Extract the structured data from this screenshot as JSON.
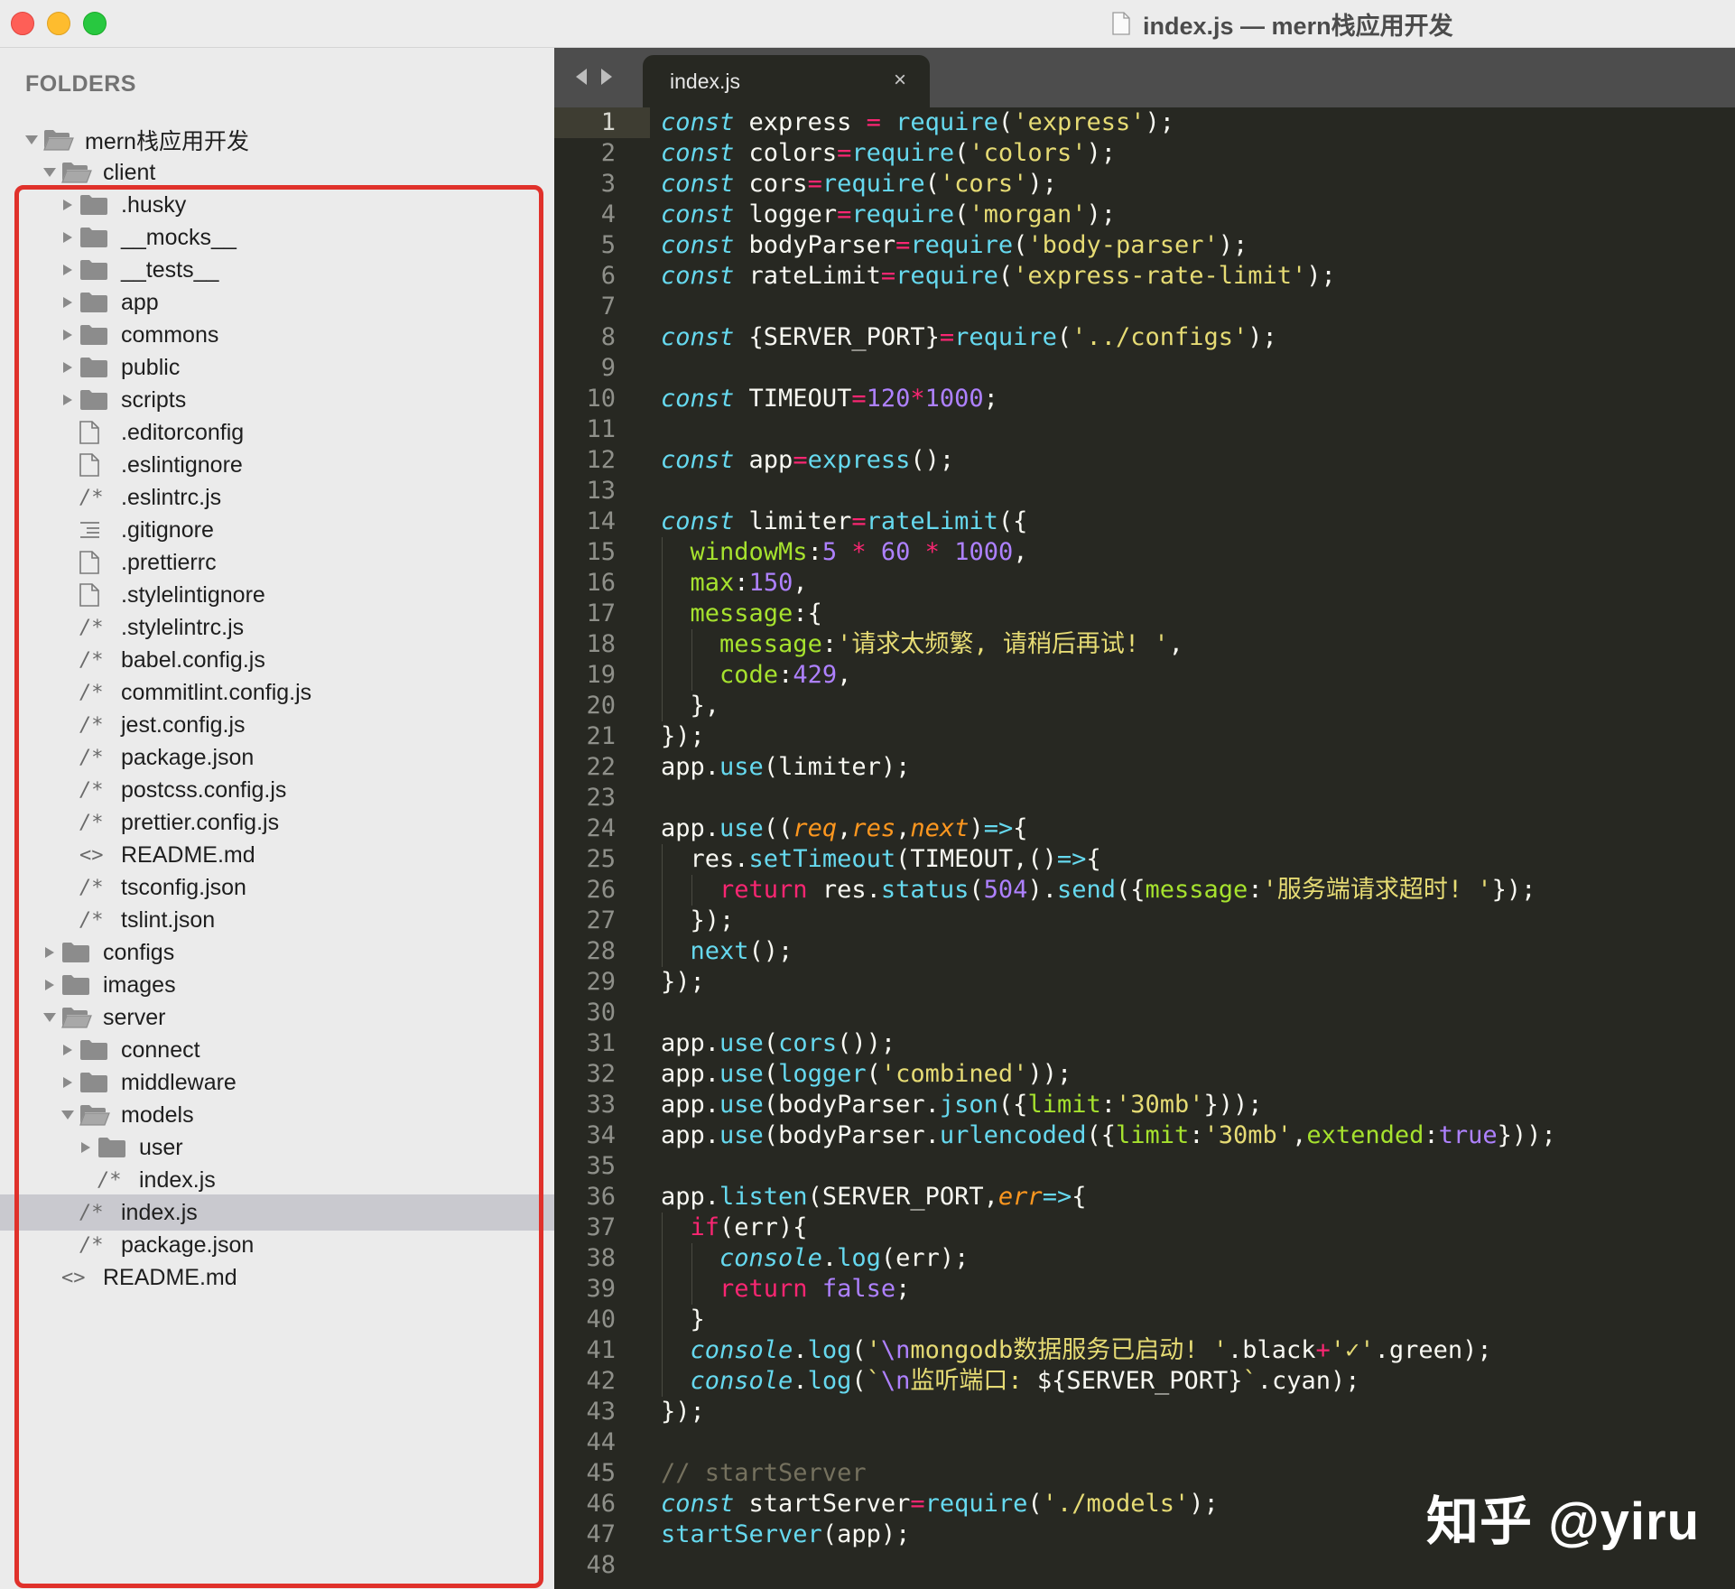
{
  "window": {
    "title": "index.js — mern栈应用开发"
  },
  "sidebar": {
    "header": "FOLDERS",
    "items": [
      {
        "label": "mern栈应用开发",
        "kind": "folder-open",
        "depth": 0
      },
      {
        "label": "client",
        "kind": "folder-open",
        "depth": 1
      },
      {
        "label": ".husky",
        "kind": "folder",
        "depth": 2
      },
      {
        "label": "__mocks__",
        "kind": "folder",
        "depth": 2
      },
      {
        "label": "__tests__",
        "kind": "folder",
        "depth": 2
      },
      {
        "label": "app",
        "kind": "folder",
        "depth": 2
      },
      {
        "label": "commons",
        "kind": "folder",
        "depth": 2
      },
      {
        "label": "public",
        "kind": "folder",
        "depth": 2
      },
      {
        "label": "scripts",
        "kind": "folder",
        "depth": 2
      },
      {
        "label": ".editorconfig",
        "kind": "file",
        "depth": 2
      },
      {
        "label": ".eslintignore",
        "kind": "file",
        "depth": 2
      },
      {
        "label": ".eslintrc.js",
        "kind": "js",
        "depth": 2
      },
      {
        "label": ".gitignore",
        "kind": "list",
        "depth": 2
      },
      {
        "label": ".prettierrc",
        "kind": "file",
        "depth": 2
      },
      {
        "label": ".stylelintignore",
        "kind": "file",
        "depth": 2
      },
      {
        "label": ".stylelintrc.js",
        "kind": "js",
        "depth": 2
      },
      {
        "label": "babel.config.js",
        "kind": "js",
        "depth": 2
      },
      {
        "label": "commitlint.config.js",
        "kind": "js",
        "depth": 2
      },
      {
        "label": "jest.config.js",
        "kind": "js",
        "depth": 2
      },
      {
        "label": "package.json",
        "kind": "js",
        "depth": 2
      },
      {
        "label": "postcss.config.js",
        "kind": "js",
        "depth": 2
      },
      {
        "label": "prettier.config.js",
        "kind": "js",
        "depth": 2
      },
      {
        "label": "README.md",
        "kind": "md",
        "depth": 2
      },
      {
        "label": "tsconfig.json",
        "kind": "js",
        "depth": 2
      },
      {
        "label": "tslint.json",
        "kind": "js",
        "depth": 2
      },
      {
        "label": "configs",
        "kind": "folder",
        "depth": 1
      },
      {
        "label": "images",
        "kind": "folder",
        "depth": 1
      },
      {
        "label": "server",
        "kind": "folder-open",
        "depth": 1
      },
      {
        "label": "connect",
        "kind": "folder",
        "depth": 2
      },
      {
        "label": "middleware",
        "kind": "folder",
        "depth": 2
      },
      {
        "label": "models",
        "kind": "folder-open",
        "depth": 2
      },
      {
        "label": "user",
        "kind": "folder",
        "depth": 3
      },
      {
        "label": "index.js",
        "kind": "js",
        "depth": 3
      },
      {
        "label": "index.js",
        "kind": "js",
        "depth": 2,
        "selected": true
      },
      {
        "label": "package.json",
        "kind": "js",
        "depth": 2
      },
      {
        "label": "README.md",
        "kind": "md",
        "depth": 1
      }
    ]
  },
  "editor": {
    "tab_label": "index.js",
    "tab_close": "×",
    "lines": [
      [
        [
          "st",
          "const"
        ],
        [
          "t",
          " express "
        ],
        [
          "k",
          "="
        ],
        [
          "t",
          " "
        ],
        [
          "f",
          "require"
        ],
        [
          "t",
          "("
        ],
        [
          "s",
          "'express'"
        ],
        [
          "t",
          ");"
        ]
      ],
      [
        [
          "st",
          "const"
        ],
        [
          "t",
          " colors"
        ],
        [
          "k",
          "="
        ],
        [
          "f",
          "require"
        ],
        [
          "t",
          "("
        ],
        [
          "s",
          "'colors'"
        ],
        [
          "t",
          ");"
        ]
      ],
      [
        [
          "st",
          "const"
        ],
        [
          "t",
          " cors"
        ],
        [
          "k",
          "="
        ],
        [
          "f",
          "require"
        ],
        [
          "t",
          "("
        ],
        [
          "s",
          "'cors'"
        ],
        [
          "t",
          ");"
        ]
      ],
      [
        [
          "st",
          "const"
        ],
        [
          "t",
          " logger"
        ],
        [
          "k",
          "="
        ],
        [
          "f",
          "require"
        ],
        [
          "t",
          "("
        ],
        [
          "s",
          "'morgan'"
        ],
        [
          "t",
          ");"
        ]
      ],
      [
        [
          "st",
          "const"
        ],
        [
          "t",
          " bodyParser"
        ],
        [
          "k",
          "="
        ],
        [
          "f",
          "require"
        ],
        [
          "t",
          "("
        ],
        [
          "s",
          "'body-parser'"
        ],
        [
          "t",
          ");"
        ]
      ],
      [
        [
          "st",
          "const"
        ],
        [
          "t",
          " rateLimit"
        ],
        [
          "k",
          "="
        ],
        [
          "f",
          "require"
        ],
        [
          "t",
          "("
        ],
        [
          "s",
          "'express-rate-limit'"
        ],
        [
          "t",
          ");"
        ]
      ],
      [],
      [
        [
          "st",
          "const"
        ],
        [
          "t",
          " {SERVER_PORT}"
        ],
        [
          "k",
          "="
        ],
        [
          "f",
          "require"
        ],
        [
          "t",
          "("
        ],
        [
          "s",
          "'../configs'"
        ],
        [
          "t",
          ");"
        ]
      ],
      [],
      [
        [
          "st",
          "const"
        ],
        [
          "t",
          " TIMEOUT"
        ],
        [
          "k",
          "="
        ],
        [
          "n",
          "120"
        ],
        [
          "k",
          "*"
        ],
        [
          "n",
          "1000"
        ],
        [
          "t",
          ";"
        ]
      ],
      [],
      [
        [
          "st",
          "const"
        ],
        [
          "t",
          " app"
        ],
        [
          "k",
          "="
        ],
        [
          "f",
          "express"
        ],
        [
          "t",
          "();"
        ]
      ],
      [],
      [
        [
          "st",
          "const"
        ],
        [
          "t",
          " limiter"
        ],
        [
          "k",
          "="
        ],
        [
          "f",
          "rateLimit"
        ],
        [
          "t",
          "({"
        ]
      ],
      [
        [
          "t",
          "  "
        ],
        [
          "pr",
          "windowMs"
        ],
        [
          "t",
          ":"
        ],
        [
          "n",
          "5"
        ],
        [
          "t",
          " "
        ],
        [
          "k",
          "*"
        ],
        [
          "t",
          " "
        ],
        [
          "n",
          "60"
        ],
        [
          "t",
          " "
        ],
        [
          "k",
          "*"
        ],
        [
          "t",
          " "
        ],
        [
          "n",
          "1000"
        ],
        [
          "t",
          ","
        ]
      ],
      [
        [
          "t",
          "  "
        ],
        [
          "pr",
          "max"
        ],
        [
          "t",
          ":"
        ],
        [
          "n",
          "150"
        ],
        [
          "t",
          ","
        ]
      ],
      [
        [
          "t",
          "  "
        ],
        [
          "pr",
          "message"
        ],
        [
          "t",
          ":{"
        ]
      ],
      [
        [
          "t",
          "    "
        ],
        [
          "pr",
          "message"
        ],
        [
          "t",
          ":"
        ],
        [
          "s",
          "'请求太频繁, 请稍后再试! '"
        ],
        [
          "t",
          ","
        ]
      ],
      [
        [
          "t",
          "    "
        ],
        [
          "pr",
          "code"
        ],
        [
          "t",
          ":"
        ],
        [
          "n",
          "429"
        ],
        [
          "t",
          ","
        ]
      ],
      [
        [
          "t",
          "  },"
        ]
      ],
      [
        [
          "t",
          "});"
        ]
      ],
      [
        [
          "t",
          "app."
        ],
        [
          "f",
          "use"
        ],
        [
          "t",
          "(limiter);"
        ]
      ],
      [],
      [
        [
          "t",
          "app."
        ],
        [
          "f",
          "use"
        ],
        [
          "t",
          "(("
        ],
        [
          "p",
          "req"
        ],
        [
          "t",
          ","
        ],
        [
          "p",
          "res"
        ],
        [
          "t",
          ","
        ],
        [
          "p",
          "next"
        ],
        [
          "t",
          ")"
        ],
        [
          "st",
          "=>"
        ],
        [
          "t",
          "{"
        ]
      ],
      [
        [
          "t",
          "  res."
        ],
        [
          "f",
          "setTimeout"
        ],
        [
          "t",
          "(TIMEOUT,()"
        ],
        [
          "st",
          "=>"
        ],
        [
          "t",
          "{"
        ]
      ],
      [
        [
          "t",
          "    "
        ],
        [
          "k",
          "return"
        ],
        [
          "t",
          " res."
        ],
        [
          "f",
          "status"
        ],
        [
          "t",
          "("
        ],
        [
          "n",
          "504"
        ],
        [
          "t",
          ")."
        ],
        [
          "f",
          "send"
        ],
        [
          "t",
          "({"
        ],
        [
          "pr",
          "message"
        ],
        [
          "t",
          ":"
        ],
        [
          "s",
          "'服务端请求超时! '"
        ],
        [
          "t",
          "});"
        ]
      ],
      [
        [
          "t",
          "  });"
        ]
      ],
      [
        [
          "t",
          "  "
        ],
        [
          "f",
          "next"
        ],
        [
          "t",
          "();"
        ]
      ],
      [
        [
          "t",
          "});"
        ]
      ],
      [],
      [
        [
          "t",
          "app."
        ],
        [
          "f",
          "use"
        ],
        [
          "t",
          "("
        ],
        [
          "f",
          "cors"
        ],
        [
          "t",
          "());"
        ]
      ],
      [
        [
          "t",
          "app."
        ],
        [
          "f",
          "use"
        ],
        [
          "t",
          "("
        ],
        [
          "f",
          "logger"
        ],
        [
          "t",
          "("
        ],
        [
          "s",
          "'combined'"
        ],
        [
          "t",
          "));"
        ]
      ],
      [
        [
          "t",
          "app."
        ],
        [
          "f",
          "use"
        ],
        [
          "t",
          "(bodyParser."
        ],
        [
          "f",
          "json"
        ],
        [
          "t",
          "({"
        ],
        [
          "pr",
          "limit"
        ],
        [
          "t",
          ":"
        ],
        [
          "s",
          "'30mb'"
        ],
        [
          "t",
          "}));"
        ]
      ],
      [
        [
          "t",
          "app."
        ],
        [
          "f",
          "use"
        ],
        [
          "t",
          "(bodyParser."
        ],
        [
          "f",
          "urlencoded"
        ],
        [
          "t",
          "({"
        ],
        [
          "pr",
          "limit"
        ],
        [
          "t",
          ":"
        ],
        [
          "s",
          "'30mb'"
        ],
        [
          "t",
          ","
        ],
        [
          "pr",
          "extended"
        ],
        [
          "t",
          ":"
        ],
        [
          "n",
          "true"
        ],
        [
          "t",
          "}));"
        ]
      ],
      [],
      [
        [
          "t",
          "app."
        ],
        [
          "f",
          "listen"
        ],
        [
          "t",
          "(SERVER_PORT,"
        ],
        [
          "p",
          "err"
        ],
        [
          "st",
          "=>"
        ],
        [
          "t",
          "{"
        ]
      ],
      [
        [
          "t",
          "  "
        ],
        [
          "k",
          "if"
        ],
        [
          "t",
          "(err){"
        ]
      ],
      [
        [
          "t",
          "    "
        ],
        [
          "st",
          "console"
        ],
        [
          "t",
          "."
        ],
        [
          "f",
          "log"
        ],
        [
          "t",
          "(err);"
        ]
      ],
      [
        [
          "t",
          "    "
        ],
        [
          "k",
          "return"
        ],
        [
          "t",
          " "
        ],
        [
          "n",
          "false"
        ],
        [
          "t",
          ";"
        ]
      ],
      [
        [
          "t",
          "  }"
        ]
      ],
      [
        [
          "t",
          "  "
        ],
        [
          "st",
          "console"
        ],
        [
          "t",
          "."
        ],
        [
          "f",
          "log"
        ],
        [
          "t",
          "("
        ],
        [
          "s",
          "'"
        ],
        [
          "n",
          "\\n"
        ],
        [
          "s",
          "mongodb数据服务已启动! '"
        ],
        [
          "t",
          ".black"
        ],
        [
          "k",
          "+"
        ],
        [
          "s",
          "'✓'"
        ],
        [
          "t",
          ".green);"
        ]
      ],
      [
        [
          "t",
          "  "
        ],
        [
          "st",
          "console"
        ],
        [
          "t",
          "."
        ],
        [
          "f",
          "log"
        ],
        [
          "t",
          "("
        ],
        [
          "s",
          "`"
        ],
        [
          "n",
          "\\n"
        ],
        [
          "s",
          "监听端口: "
        ],
        [
          "t",
          "${SERVER_PORT}"
        ],
        [
          "s",
          "`"
        ],
        [
          "t",
          ".cyan);"
        ]
      ],
      [
        [
          "t",
          "});"
        ]
      ],
      [],
      [
        [
          "c",
          "// startServer"
        ]
      ],
      [
        [
          "st",
          "const"
        ],
        [
          "t",
          " startServer"
        ],
        [
          "k",
          "="
        ],
        [
          "f",
          "require"
        ],
        [
          "t",
          "("
        ],
        [
          "s",
          "'./models'"
        ],
        [
          "t",
          ");"
        ]
      ],
      [
        [
          "f",
          "startServer"
        ],
        [
          "t",
          "(app);"
        ]
      ],
      []
    ]
  },
  "watermark": "知乎 @yiru",
  "colors": {
    "editor_bg": "#272822",
    "sidebar_bg": "#ebebeb",
    "highlight_frame": "#e0312b",
    "selected_row": "#c9c9cf"
  }
}
